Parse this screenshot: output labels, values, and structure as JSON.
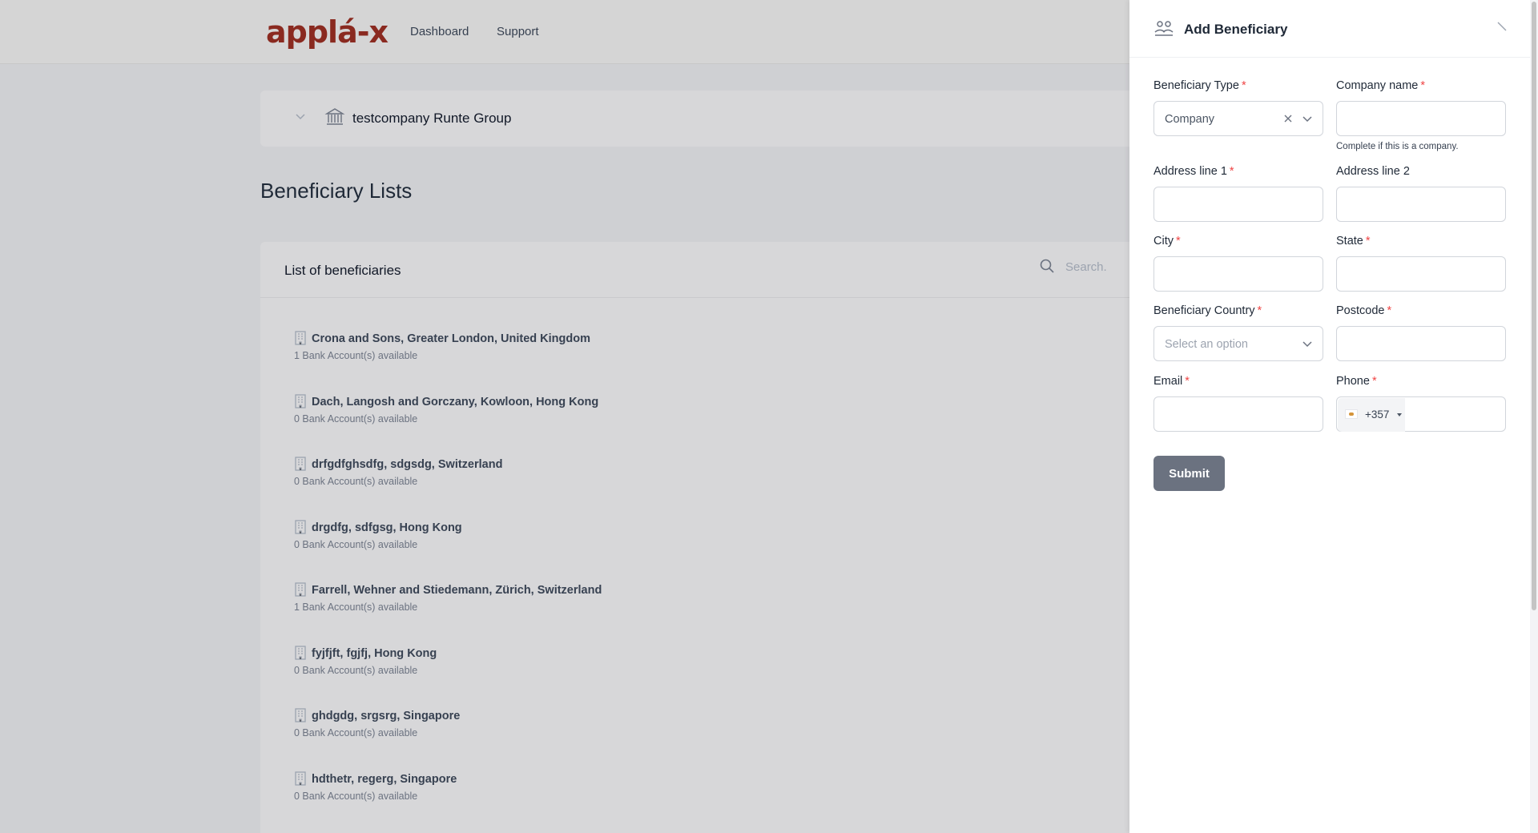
{
  "app": {
    "logo": "applá-x"
  },
  "nav": {
    "dashboard": "Dashboard",
    "support": "Support"
  },
  "company": {
    "name": "testcompany Runte Group"
  },
  "page": {
    "title": "Beneficiary Lists"
  },
  "list": {
    "title": "List of beneficiaries",
    "search_placeholder": "Search.",
    "items": [
      {
        "name": "Crona and Sons, Greater London, United Kingdom",
        "accounts": "1 Bank Account(s) available"
      },
      {
        "name": "Dach, Langosh and Gorczany, Kowloon, Hong Kong",
        "accounts": "0 Bank Account(s) available"
      },
      {
        "name": "drfgdfghsdfg, sdgsdg, Switzerland",
        "accounts": "0 Bank Account(s) available"
      },
      {
        "name": "drgdfg, sdfgsg, Hong Kong",
        "accounts": "0 Bank Account(s) available"
      },
      {
        "name": "Farrell, Wehner and Stiedemann, Zürich, Switzerland",
        "accounts": "1 Bank Account(s) available"
      },
      {
        "name": "fyjfjft, fgjfj, Hong Kong",
        "accounts": "0 Bank Account(s) available"
      },
      {
        "name": "ghdgdg, srgsrg, Singapore",
        "accounts": "0 Bank Account(s) available"
      },
      {
        "name": "hdthetr, regerg, Singapore",
        "accounts": "0 Bank Account(s) available"
      }
    ]
  },
  "panel": {
    "title": "Add Beneficiary",
    "required_mark": "*",
    "fields": {
      "beneficiary_type": {
        "label": "Beneficiary Type",
        "value": "Company"
      },
      "company_name": {
        "label": "Company name",
        "value": "",
        "hint": "Complete if this is a company."
      },
      "address1": {
        "label": "Address line 1",
        "value": ""
      },
      "address2": {
        "label": "Address line 2",
        "value": ""
      },
      "city": {
        "label": "City",
        "value": ""
      },
      "state": {
        "label": "State",
        "value": ""
      },
      "country": {
        "label": "Beneficiary Country",
        "placeholder": "Select an option"
      },
      "postcode": {
        "label": "Postcode",
        "value": ""
      },
      "email": {
        "label": "Email",
        "value": ""
      },
      "phone": {
        "label": "Phone",
        "dial_code": "+357",
        "value": ""
      }
    },
    "submit_label": "Submit"
  },
  "colors": {
    "brand": "#8a2a20",
    "required": "#ef4444",
    "submit_bg": "#6b7280"
  },
  "icons": {
    "chevron": "chevron-down-icon",
    "bank": "bank-icon",
    "search": "search-icon",
    "building": "building-icon",
    "users": "users-icon",
    "close": "close-icon",
    "clear": "clear-icon",
    "flag": "cyprus-flag-icon"
  }
}
